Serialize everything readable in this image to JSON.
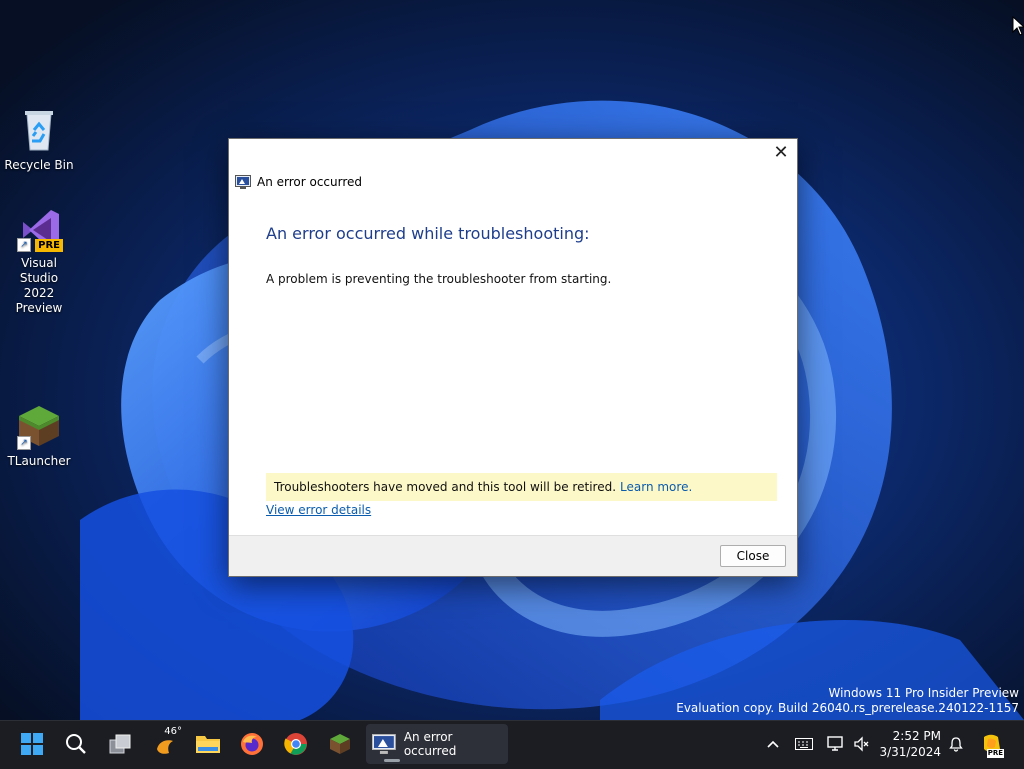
{
  "desktop": {
    "icons": [
      {
        "label_line1": "Recycle Bin",
        "label_line2": ""
      },
      {
        "label_line1": "Visual Studio",
        "label_line2": "2022 Preview",
        "badge": "PRE"
      },
      {
        "label_line1": "TLauncher",
        "label_line2": ""
      }
    ]
  },
  "dialog": {
    "window_title": "An error occurred",
    "heading": "An error occurred while troubleshooting:",
    "message": "A problem is preventing the troubleshooter from starting.",
    "banner_text": "Troubleshooters have moved and this tool will be retired.",
    "banner_link": "Learn more.",
    "details_link": "View error details",
    "close_button": "Close"
  },
  "watermark": {
    "line1": "Windows 11 Pro Insider Preview",
    "line2": "Evaluation copy. Build 26040.rs_prerelease.240122-1157"
  },
  "taskbar": {
    "weather_temp": "46°",
    "active_window_label": "An error occurred",
    "time": "2:52 PM",
    "date": "3/31/2024",
    "copilot_badge": "PRE"
  },
  "colors": {
    "accent_blue": "#1e3e8c",
    "link_blue": "#0b5cad",
    "banner_yellow": "#fdf8c8",
    "taskbar_bg": "#1b1d23"
  }
}
